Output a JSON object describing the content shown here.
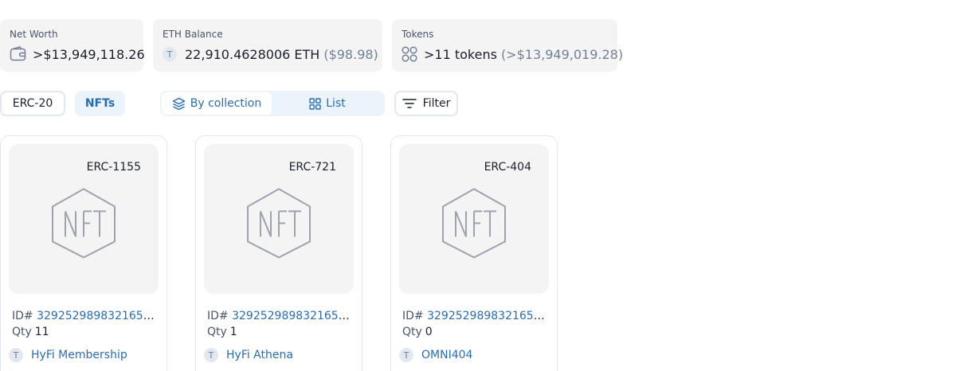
{
  "stats": {
    "net_worth": {
      "label": "Net Worth",
      "value": ">$13,949,118.26",
      "icon": "wallet-icon"
    },
    "eth_balance": {
      "label": "ETH Balance",
      "badge": "T",
      "value": "22,910.4628006 ETH",
      "usd": "($98.98)"
    },
    "tokens": {
      "label": "Tokens",
      "value": ">11 tokens",
      "usd": "(>$13,949,019.28)",
      "icon": "tokens-icon"
    }
  },
  "tabs": {
    "erc20": "ERC-20",
    "nfts": "NFTs",
    "active": "NFTs"
  },
  "view_toggle": {
    "by_collection": "By collection",
    "list": "List",
    "active": "By collection"
  },
  "filter": {
    "label": "Filter"
  },
  "nfts": [
    {
      "type": "ERC-1155",
      "id_label": "ID#",
      "id": "3292529898321655...",
      "qty_label": "Qty",
      "qty": "11",
      "badge": "T",
      "collection": "HyFi Membership"
    },
    {
      "type": "ERC-721",
      "id_label": "ID#",
      "id": "3292529898321655...",
      "qty_label": "Qty",
      "qty": "1",
      "badge": "T",
      "collection": "HyFi Athena"
    },
    {
      "type": "ERC-404",
      "id_label": "ID#",
      "id": "3292529898321655...",
      "qty_label": "Qty",
      "qty": "0",
      "badge": "T",
      "collection": "OMNI404"
    }
  ],
  "colors": {
    "accent": "#2b6cb0",
    "card_bg": "#f4f4f5",
    "border": "#e2e8f0",
    "tab_active_bg": "#ebf4fb"
  }
}
